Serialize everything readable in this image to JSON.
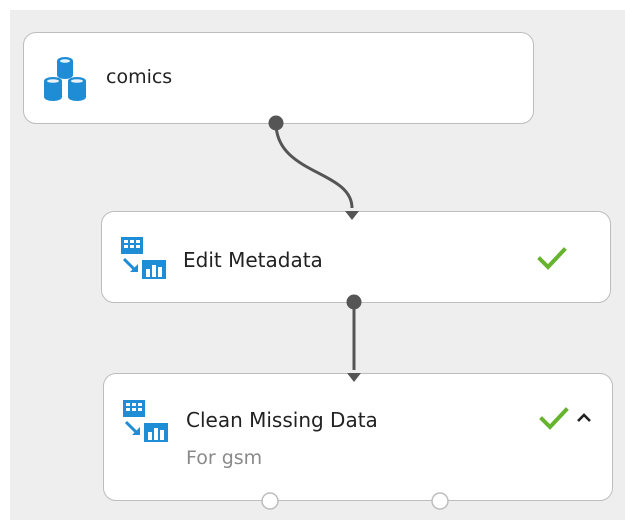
{
  "colors": {
    "canvas_bg": "#eeeeee",
    "node_border": "#bdbdbd",
    "icon_blue": "#1f8dd6",
    "check_green": "#66b32e",
    "wire": "#555555"
  },
  "nodes": [
    {
      "title": "comics",
      "icon": "dataset-cylinders-icon",
      "status": null
    },
    {
      "title": "Edit Metadata",
      "icon": "module-grid-chart-icon",
      "status": "completed-check-icon"
    },
    {
      "title": "Clean Missing Data",
      "subtitle": "For gsm",
      "icon": "module-grid-chart-icon",
      "status": "completed-check-icon",
      "collapse_icon": "chevron-up-icon"
    }
  ]
}
